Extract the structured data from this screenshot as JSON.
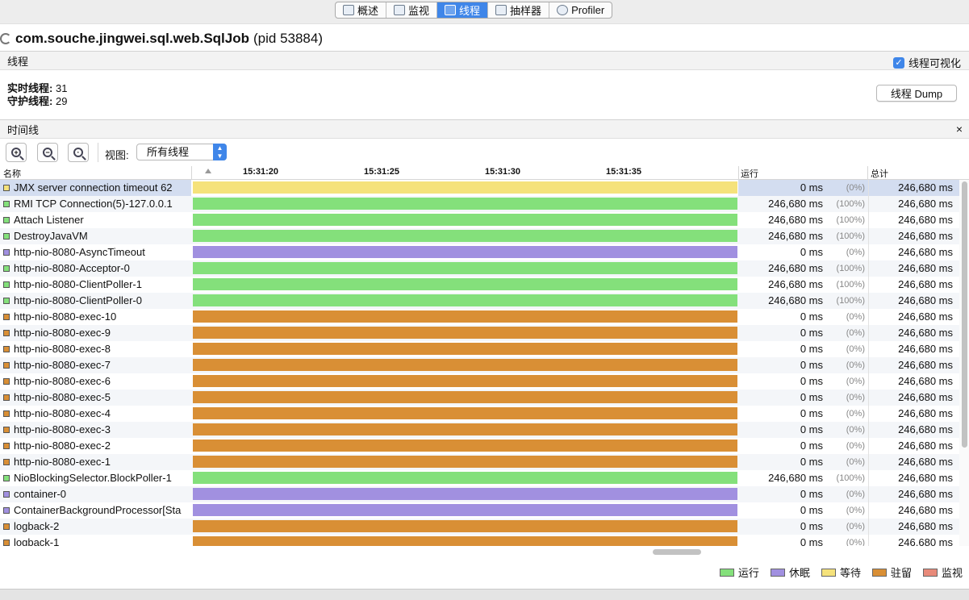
{
  "tabs": [
    {
      "label": "概述",
      "icon": "overview-icon",
      "active": false
    },
    {
      "label": "监视",
      "icon": "monitor-icon",
      "active": false
    },
    {
      "label": "线程",
      "icon": "threads-icon",
      "active": true
    },
    {
      "label": "抽样器",
      "icon": "sampler-icon",
      "active": false
    },
    {
      "label": "Profiler",
      "icon": "profiler-icon",
      "active": false
    }
  ],
  "header": {
    "app_name": "com.souche.jingwei.sql.web.SqlJob",
    "pid": "(pid 53884)"
  },
  "threads_section": {
    "title": "线程",
    "visualize_label": "线程可视化",
    "visualize_checked": true,
    "live_label": "实时线程:",
    "live_value": "31",
    "daemon_label": "守护线程:",
    "daemon_value": "29",
    "dump_button": "线程 Dump"
  },
  "timeline_section": {
    "title": "时间线",
    "close": "×",
    "view_label": "视图:",
    "view_value": "所有线程"
  },
  "columns": {
    "name": "名称",
    "run": "运行",
    "total": "总计",
    "ticks": [
      "15:31:20",
      "15:31:25",
      "15:31:30",
      "15:31:35"
    ]
  },
  "state_colors": {
    "running": "#84e07b",
    "sleeping": "#a190e0",
    "waiting": "#f5e27b",
    "parked": "#d98f35",
    "monitor": "#e88a7a"
  },
  "rows": [
    {
      "name": "JMX server connection timeout 62",
      "state": "waiting",
      "run": "0 ms",
      "pct": "(0%)",
      "total": "246,680 ms"
    },
    {
      "name": "RMI TCP Connection(5)-127.0.0.1",
      "state": "running",
      "run": "246,680 ms",
      "pct": "(100%)",
      "total": "246,680 ms"
    },
    {
      "name": "Attach Listener",
      "state": "running",
      "run": "246,680 ms",
      "pct": "(100%)",
      "total": "246,680 ms"
    },
    {
      "name": "DestroyJavaVM",
      "state": "running",
      "run": "246,680 ms",
      "pct": "(100%)",
      "total": "246,680 ms"
    },
    {
      "name": "http-nio-8080-AsyncTimeout",
      "state": "sleeping",
      "run": "0 ms",
      "pct": "(0%)",
      "total": "246,680 ms"
    },
    {
      "name": "http-nio-8080-Acceptor-0",
      "state": "running",
      "run": "246,680 ms",
      "pct": "(100%)",
      "total": "246,680 ms"
    },
    {
      "name": "http-nio-8080-ClientPoller-1",
      "state": "running",
      "run": "246,680 ms",
      "pct": "(100%)",
      "total": "246,680 ms"
    },
    {
      "name": "http-nio-8080-ClientPoller-0",
      "state": "running",
      "run": "246,680 ms",
      "pct": "(100%)",
      "total": "246,680 ms"
    },
    {
      "name": "http-nio-8080-exec-10",
      "state": "parked",
      "run": "0 ms",
      "pct": "(0%)",
      "total": "246,680 ms"
    },
    {
      "name": "http-nio-8080-exec-9",
      "state": "parked",
      "run": "0 ms",
      "pct": "(0%)",
      "total": "246,680 ms"
    },
    {
      "name": "http-nio-8080-exec-8",
      "state": "parked",
      "run": "0 ms",
      "pct": "(0%)",
      "total": "246,680 ms"
    },
    {
      "name": "http-nio-8080-exec-7",
      "state": "parked",
      "run": "0 ms",
      "pct": "(0%)",
      "total": "246,680 ms"
    },
    {
      "name": "http-nio-8080-exec-6",
      "state": "parked",
      "run": "0 ms",
      "pct": "(0%)",
      "total": "246,680 ms"
    },
    {
      "name": "http-nio-8080-exec-5",
      "state": "parked",
      "run": "0 ms",
      "pct": "(0%)",
      "total": "246,680 ms"
    },
    {
      "name": "http-nio-8080-exec-4",
      "state": "parked",
      "run": "0 ms",
      "pct": "(0%)",
      "total": "246,680 ms"
    },
    {
      "name": "http-nio-8080-exec-3",
      "state": "parked",
      "run": "0 ms",
      "pct": "(0%)",
      "total": "246,680 ms"
    },
    {
      "name": "http-nio-8080-exec-2",
      "state": "parked",
      "run": "0 ms",
      "pct": "(0%)",
      "total": "246,680 ms"
    },
    {
      "name": "http-nio-8080-exec-1",
      "state": "parked",
      "run": "0 ms",
      "pct": "(0%)",
      "total": "246,680 ms"
    },
    {
      "name": "NioBlockingSelector.BlockPoller-1",
      "state": "running",
      "run": "246,680 ms",
      "pct": "(100%)",
      "total": "246,680 ms"
    },
    {
      "name": "container-0",
      "state": "sleeping",
      "run": "0 ms",
      "pct": "(0%)",
      "total": "246,680 ms"
    },
    {
      "name": "ContainerBackgroundProcessor[Sta",
      "state": "sleeping",
      "run": "0 ms",
      "pct": "(0%)",
      "total": "246,680 ms"
    },
    {
      "name": "logback-2",
      "state": "parked",
      "run": "0 ms",
      "pct": "(0%)",
      "total": "246,680 ms"
    },
    {
      "name": "logback-1",
      "state": "parked",
      "run": "0 ms",
      "pct": "(0%)",
      "total": "246,680 ms"
    }
  ],
  "legend": [
    {
      "label": "运行",
      "state": "running"
    },
    {
      "label": "休眠",
      "state": "sleeping"
    },
    {
      "label": "等待",
      "state": "waiting"
    },
    {
      "label": "驻留",
      "state": "parked"
    },
    {
      "label": "监视",
      "state": "monitor"
    }
  ]
}
